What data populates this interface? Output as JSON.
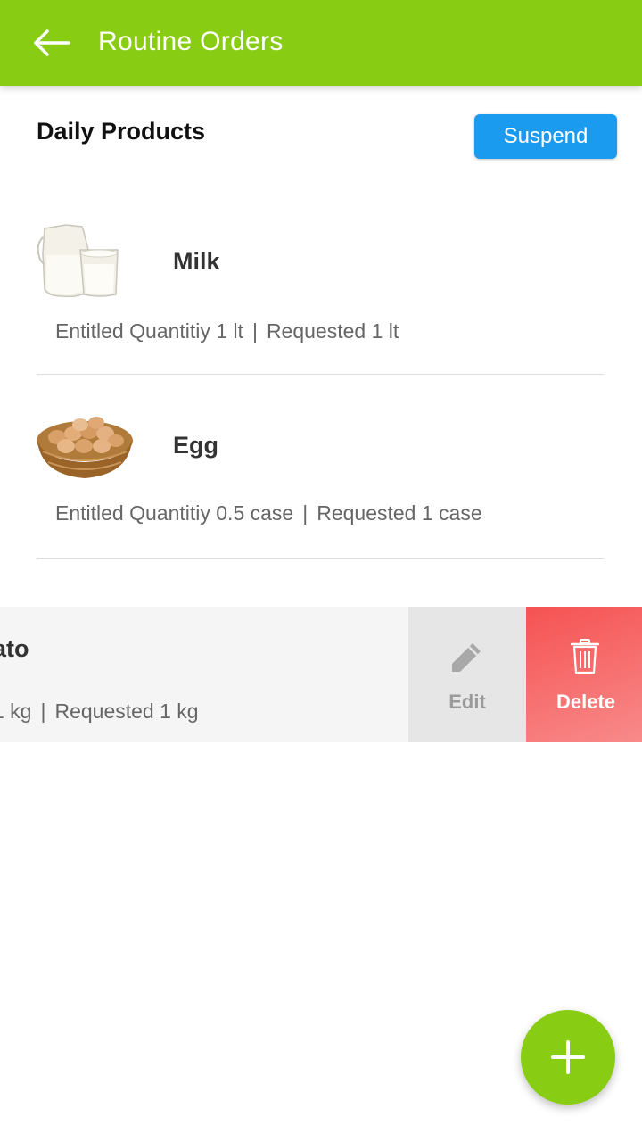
{
  "appbar": {
    "title": "Routine Orders",
    "back_icon": "arrow-left-icon",
    "color": "#88cc14"
  },
  "section": {
    "title": "Daily Products",
    "suspend_label": "Suspend",
    "suspend_color": "#1a9bf0"
  },
  "products": [
    {
      "name": "Milk",
      "image": "milk-jug-and-glass",
      "entitled": "Entitled Quantitiy 1 lt",
      "separator": "|",
      "requested": "Requested 1 lt"
    },
    {
      "name": "Egg",
      "image": "egg-basket",
      "entitled": "Entitled Quantitiy 0.5 case",
      "separator": "|",
      "requested": "Requested 1 case"
    }
  ],
  "swiped_item": {
    "name_fragment": "ato",
    "entitled_fragment": "1 kg",
    "separator": "|",
    "requested": "Requested 1 kg",
    "edit_label": "Edit",
    "edit_icon": "pencil-icon",
    "delete_label": "Delete",
    "delete_icon": "trash-icon",
    "delete_color": "#f65252"
  },
  "fab": {
    "icon": "plus-icon",
    "color": "#88cc14"
  }
}
